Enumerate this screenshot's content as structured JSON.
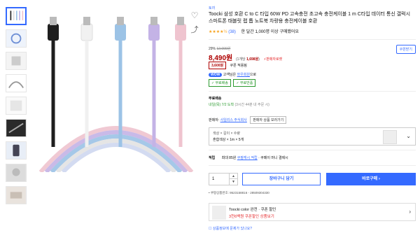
{
  "brand": "토끼",
  "title": "Toocki 삼성 호환 C to C 타입 60W PD 고속충전 초고속 충전케이블 1 m C타입 데이터 통신 갤럭시 스마트폰 태블릿 랩 톱 노트북 차량용 충전케이블 호환",
  "rating": {
    "stars": "★★★★½",
    "count": "(38)",
    "bought": "한 달간 1,000명 이상 구매했어요"
  },
  "discount": {
    "percent": "29%",
    "original": "12,000원"
  },
  "coupon_button": "쿠폰받기",
  "price": {
    "value": "8,490원",
    "unit_prefix": "(1개당 ",
    "unit_price": "1,698원",
    "unit_suffix": ")",
    "badge": "⚡판매자로켓"
  },
  "coupon": {
    "amount": "3,600원",
    "label": "쿠폰 적용됨"
  },
  "wow": {
    "badge": "WOW",
    "text": "고객님은 ",
    "link": "와우회원",
    "tail": "으로"
  },
  "green_tags": [
    "✓ 무료배송",
    "✓ 무료반품"
  ],
  "shipping": {
    "title": "무료배송",
    "arrival_day": "내일(목)",
    "arrival_date": "7/2 도착",
    "note": " (3시간 44분 내 주문 시)"
  },
  "sellers": {
    "text": "판매자: ",
    "link": "사일리스 주식회사",
    "other": "판매자 상품 보러가기"
  },
  "option": {
    "label": "색상 × 길이 × 수량",
    "value": "혼합색상 × 1m × 5개",
    "chevron": "⌄"
  },
  "point": {
    "label": "적립",
    "text": "최대 85원 ",
    "cash": "쿠팡캐시 적립",
    "tail": " · 쿠페이 머니 결제시"
  },
  "quantity": {
    "value": "1",
    "up": "▲",
    "down": "▼"
  },
  "buttons": {
    "cart": "장바구니 담기",
    "buy": "바로구매 ›"
  },
  "codes": "• 쿠팡상품번호: 9523158816 - 28509304330",
  "promo": {
    "line1": "Toocki  color 완전 · 쿠폰 할인",
    "line2": "3천6백원 쿠폰할인 상품보기",
    "chevron": "›"
  },
  "report": "☐ 상품정보에 문제가 있나요?",
  "icons": {
    "heart": "♡",
    "share": "⤴"
  },
  "colors": {
    "accent": "#346aff",
    "price": "#ae0000",
    "green": "#2b9a2f"
  }
}
